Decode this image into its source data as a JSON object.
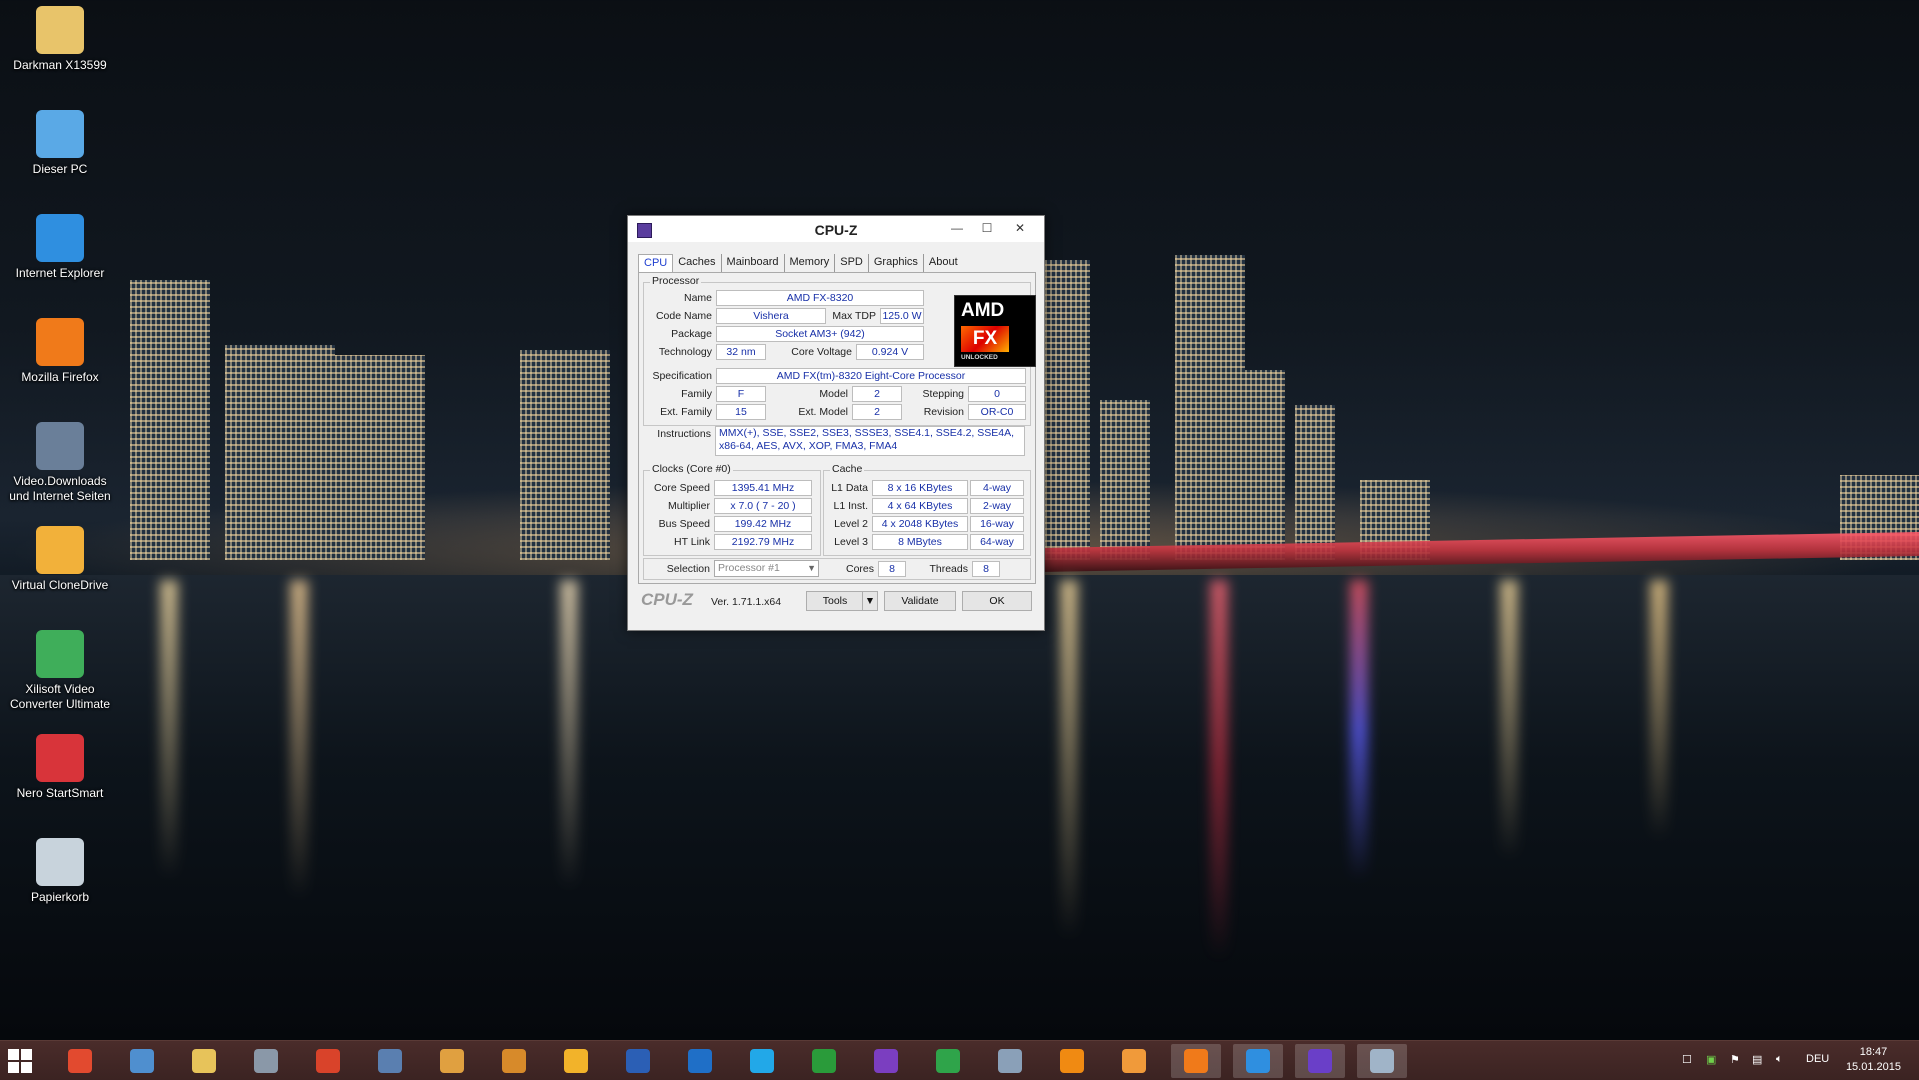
{
  "desktop": {
    "icons": [
      {
        "label": "Darkman X13599",
        "icon": "folder-icon",
        "color": "#e8c46a"
      },
      {
        "label": "Dieser PC",
        "icon": "computer-icon",
        "color": "#5aa9e6"
      },
      {
        "label": "Internet Explorer",
        "icon": "internet-explorer-icon",
        "color": "#2f8fe0"
      },
      {
        "label": "Mozilla Firefox",
        "icon": "firefox-icon",
        "color": "#f07a1a"
      },
      {
        "label": "Video.Downloads und Internet Seiten",
        "icon": "video-download-icon",
        "color": "#6a7f99"
      },
      {
        "label": "Virtual CloneDrive",
        "icon": "virtual-clonedrive-icon",
        "color": "#f2b13a"
      },
      {
        "label": "Xilisoft Video Converter Ultimate",
        "icon": "xilisoft-icon",
        "color": "#3fae5a"
      },
      {
        "label": "Nero StartSmart",
        "icon": "nero-icon",
        "color": "#d8343a"
      },
      {
        "label": "Papierkorb",
        "icon": "recycle-bin-icon",
        "color": "#c8d3dc"
      }
    ]
  },
  "cpuz": {
    "title": "CPU-Z",
    "tabs": [
      "CPU",
      "Caches",
      "Mainboard",
      "Memory",
      "SPD",
      "Graphics",
      "About"
    ],
    "processor": {
      "group_title": "Processor",
      "name_label": "Name",
      "name": "AMD FX-8320",
      "codename_label": "Code Name",
      "codename": "Vishera",
      "maxtdp_label": "Max TDP",
      "maxtdp": "125.0 W",
      "package_label": "Package",
      "package": "Socket AM3+ (942)",
      "technology_label": "Technology",
      "technology": "32 nm",
      "voltage_label": "Core Voltage",
      "voltage": "0.924 V",
      "spec_label": "Specification",
      "spec": "AMD FX(tm)-8320 Eight-Core Processor",
      "family_label": "Family",
      "family": "F",
      "model_label": "Model",
      "model": "2",
      "stepping_label": "Stepping",
      "stepping": "0",
      "extfamily_label": "Ext. Family",
      "extfamily": "15",
      "extmodel_label": "Ext. Model",
      "extmodel": "2",
      "revision_label": "Revision",
      "revision": "OR-C0",
      "instructions_label": "Instructions",
      "instructions": "MMX(+), SSE, SSE2, SSE3, SSSE3, SSE4.1, SSE4.2, SSE4A, x86-64, AES, AVX, XOP, FMA3, FMA4",
      "logo_amd": "AMD",
      "logo_fx": "FX",
      "logo_unlocked": "UNLOCKED"
    },
    "clocks": {
      "group_title": "Clocks (Core #0)",
      "corespeed_label": "Core Speed",
      "corespeed": "1395.41 MHz",
      "multiplier_label": "Multiplier",
      "multiplier": "x 7.0 ( 7 - 20 )",
      "busspeed_label": "Bus Speed",
      "busspeed": "199.42 MHz",
      "htlink_label": "HT Link",
      "htlink": "2192.79 MHz"
    },
    "cache": {
      "group_title": "Cache",
      "l1data_label": "L1 Data",
      "l1data": "8 x 16 KBytes",
      "l1data_way": "4-way",
      "l1inst_label": "L1 Inst.",
      "l1inst": "4 x 64 KBytes",
      "l1inst_way": "2-way",
      "level2_label": "Level 2",
      "level2": "4 x 2048 KBytes",
      "level2_way": "16-way",
      "level3_label": "Level 3",
      "level3": "8 MBytes",
      "level3_way": "64-way"
    },
    "selection": {
      "label": "Selection",
      "value": "Processor #1",
      "cores_label": "Cores",
      "cores": "8",
      "threads_label": "Threads",
      "threads": "8"
    },
    "footer": {
      "brand": "CPU-Z",
      "version": "Ver. 1.71.1.x64",
      "tools": "Tools",
      "validate": "Validate",
      "ok": "OK"
    }
  },
  "taskbar": {
    "apps": [
      {
        "icon": "power-icon",
        "color": "#e24a2f"
      },
      {
        "icon": "control-panel-icon",
        "color": "#4f8fcf"
      },
      {
        "icon": "file-explorer-icon",
        "color": "#e7c35a"
      },
      {
        "icon": "keyboard-icon",
        "color": "#8a98a8"
      },
      {
        "icon": "ccleaner-icon",
        "color": "#d9432a"
      },
      {
        "icon": "task-manager-icon",
        "color": "#5a7fb0"
      },
      {
        "icon": "paint-icon",
        "color": "#e0a040"
      },
      {
        "icon": "registry-icon",
        "color": "#d78a2a"
      },
      {
        "icon": "headphones-icon",
        "color": "#f2b32a"
      },
      {
        "icon": "word-icon",
        "color": "#2b5fb5"
      },
      {
        "icon": "outlook-icon",
        "color": "#1f6fc7"
      },
      {
        "icon": "skype-icon",
        "color": "#22a8e8"
      },
      {
        "icon": "store-icon",
        "color": "#2a9b3a"
      },
      {
        "icon": "trophy-icon",
        "color": "#7b3ec0"
      },
      {
        "icon": "xbox-games-icon",
        "color": "#2fa44a"
      },
      {
        "icon": "network-user-icon",
        "color": "#8aa0b8"
      },
      {
        "icon": "vlc-icon",
        "color": "#f08a12"
      },
      {
        "icon": "media-player-icon",
        "color": "#f09a3a"
      },
      {
        "icon": "firefox-icon",
        "color": "#f07a1a"
      },
      {
        "icon": "internet-explorer-icon",
        "color": "#2f8fe0"
      },
      {
        "icon": "cpuz-icon",
        "color": "#6a3fc8"
      },
      {
        "icon": "remote-desktop-icon",
        "color": "#a0b4c8"
      }
    ],
    "tray_lang": "DEU",
    "time": "18:47",
    "date": "15.01.2015"
  }
}
